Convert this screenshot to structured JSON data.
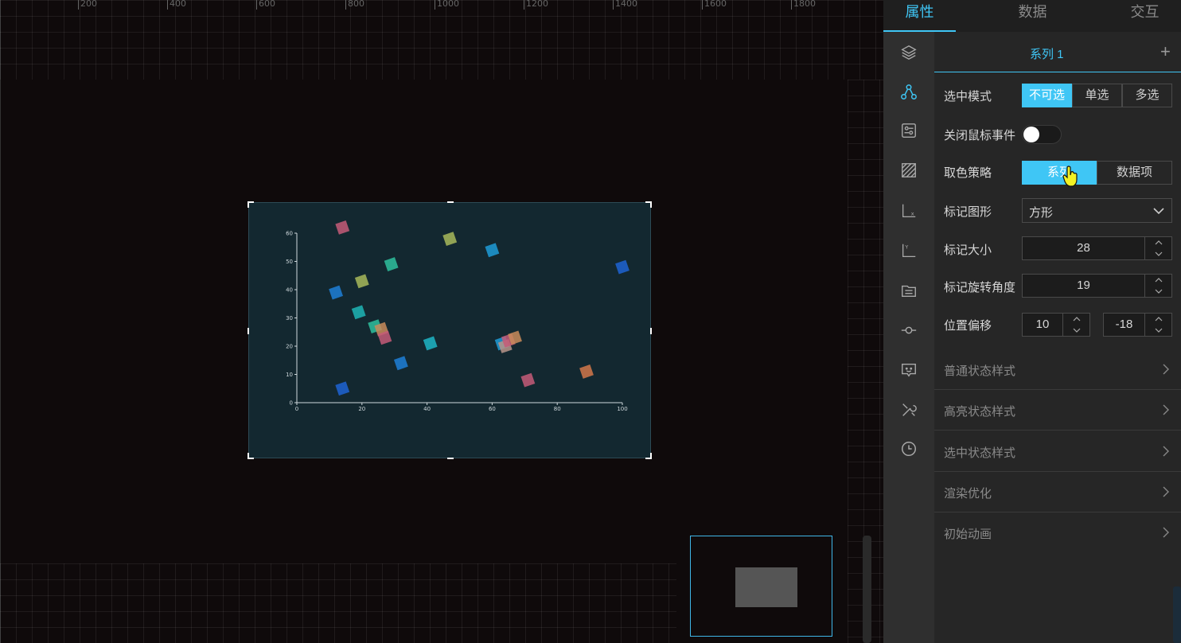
{
  "ruler": {
    "ticks": [
      "200",
      "400",
      "600",
      "800",
      "1000",
      "1200",
      "1400",
      "1600",
      "1800"
    ]
  },
  "panel": {
    "tabs": [
      {
        "label": "属性",
        "active": true
      },
      {
        "label": "数据",
        "active": false
      },
      {
        "label": "交互",
        "active": false
      }
    ],
    "side_icons": [
      "layers-icon",
      "series-icon",
      "settings-card-icon",
      "pattern-icon",
      "x-axis-icon",
      "y-axis-icon",
      "legend-icon",
      "marker-line-icon",
      "tooltip-icon",
      "tools-icon",
      "clock-icon"
    ],
    "series_tab": "系列 1",
    "add_label": "+",
    "select_mode": {
      "label": "选中模式",
      "options": [
        "不可选",
        "单选",
        "多选"
      ],
      "selected": "不可选"
    },
    "mouse_events": {
      "label": "关闭鼠标事件",
      "on": false
    },
    "color_strategy": {
      "label": "取色策略",
      "options": [
        "系列",
        "数据项"
      ],
      "selected": "系列"
    },
    "marker_shape": {
      "label": "标记图形",
      "value": "方形"
    },
    "marker_size": {
      "label": "标记大小",
      "value": "28"
    },
    "marker_rotate": {
      "label": "标记旋转角度",
      "value": "19"
    },
    "offset": {
      "label": "位置偏移",
      "x": "10",
      "y": "-18"
    },
    "accordions": [
      "普通状态样式",
      "高亮状态样式",
      "选中状态样式",
      "渲染优化",
      "初始动画"
    ],
    "accent": "#3fc6f5"
  },
  "chart_data": {
    "type": "scatter",
    "xlim": [
      0,
      100
    ],
    "ylim": [
      0,
      60
    ],
    "x_ticks": [
      "0",
      "20",
      "40",
      "60",
      "80",
      "100"
    ],
    "y_ticks": [
      "0",
      "10",
      "20",
      "30",
      "40",
      "50",
      "60"
    ],
    "marker": "square",
    "points": [
      {
        "x": 14,
        "y": 62,
        "color": "#c65a78"
      },
      {
        "x": 47,
        "y": 58,
        "color": "#a8b85a"
      },
      {
        "x": 60,
        "y": 54,
        "color": "#1e9bd7"
      },
      {
        "x": 100,
        "y": 48,
        "color": "#1e63d2"
      },
      {
        "x": 29,
        "y": 49,
        "color": "#2fbf9e"
      },
      {
        "x": 20,
        "y": 43,
        "color": "#a8b85a"
      },
      {
        "x": 12,
        "y": 39,
        "color": "#1e7fd7"
      },
      {
        "x": 19,
        "y": 32,
        "color": "#1eb5b5"
      },
      {
        "x": 24,
        "y": 27,
        "color": "#2fbf9e"
      },
      {
        "x": 26,
        "y": 26,
        "color": "#c98b5a"
      },
      {
        "x": 27,
        "y": 23,
        "color": "#c65a78"
      },
      {
        "x": 41,
        "y": 21,
        "color": "#1eb5c5"
      },
      {
        "x": 63,
        "y": 21,
        "color": "#1e9bd7"
      },
      {
        "x": 64,
        "y": 20,
        "color": "#b8948a"
      },
      {
        "x": 65,
        "y": 22,
        "color": "#c65a78"
      },
      {
        "x": 67,
        "y": 23,
        "color": "#c98b5a"
      },
      {
        "x": 32,
        "y": 14,
        "color": "#1e7fd7"
      },
      {
        "x": 89,
        "y": 11,
        "color": "#d2774a"
      },
      {
        "x": 71,
        "y": 8,
        "color": "#c65a78"
      },
      {
        "x": 14,
        "y": 5,
        "color": "#1e63d2"
      }
    ]
  }
}
